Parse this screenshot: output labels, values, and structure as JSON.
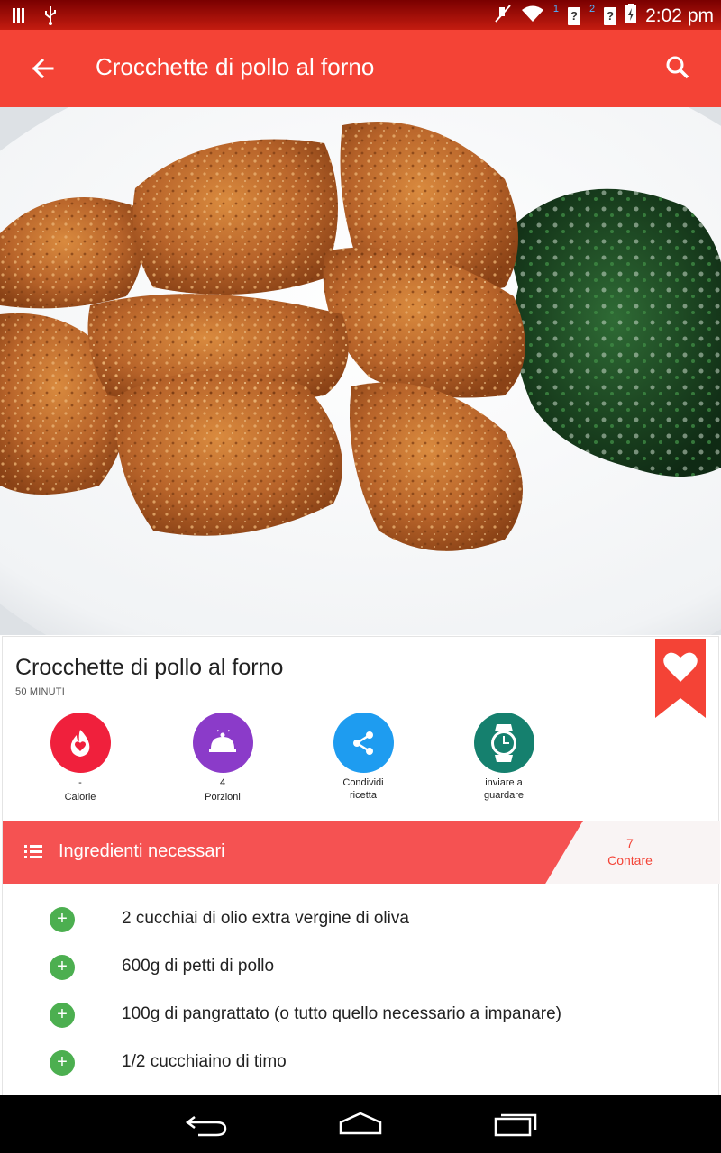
{
  "status_bar": {
    "time": "2:02 pm",
    "sim1_label": "1",
    "sim2_label": "2",
    "unknown_1": "?",
    "unknown_2": "?"
  },
  "toolbar": {
    "title": "Crocchette di pollo al forno",
    "back_icon": "arrow-back-icon",
    "search_icon": "search-icon"
  },
  "recipe": {
    "title": "Crocchette di pollo al forno",
    "time": "50 MINUTI"
  },
  "actions": [
    {
      "icon": "flame-heart-icon",
      "value": "-",
      "label": "Calorie",
      "color": "#f0203c"
    },
    {
      "icon": "serving-dish-icon",
      "value": "4",
      "label": "Porzioni",
      "color": "#8b3bc9"
    },
    {
      "icon": "share-icon",
      "value": "Condividi",
      "label": "ricetta",
      "color": "#1e9cf0"
    },
    {
      "icon": "watch-icon",
      "value": "inviare a",
      "label": "guardare",
      "color": "#15806e"
    }
  ],
  "ingredients_header": {
    "label": "Ingredienti necessari",
    "count": "7",
    "count_label": "Contare",
    "accent": "#f55252"
  },
  "ingredients": [
    "2 cucchiai di olio extra vergine di oliva",
    "600g di petti di pollo",
    "100g di pangrattato (o tutto quello necessario a impanare)",
    "1/2 cucchiaino di timo"
  ],
  "colors": {
    "primary": "#f44336",
    "status_bar": "#c41c10",
    "add_button": "#4caf50"
  }
}
